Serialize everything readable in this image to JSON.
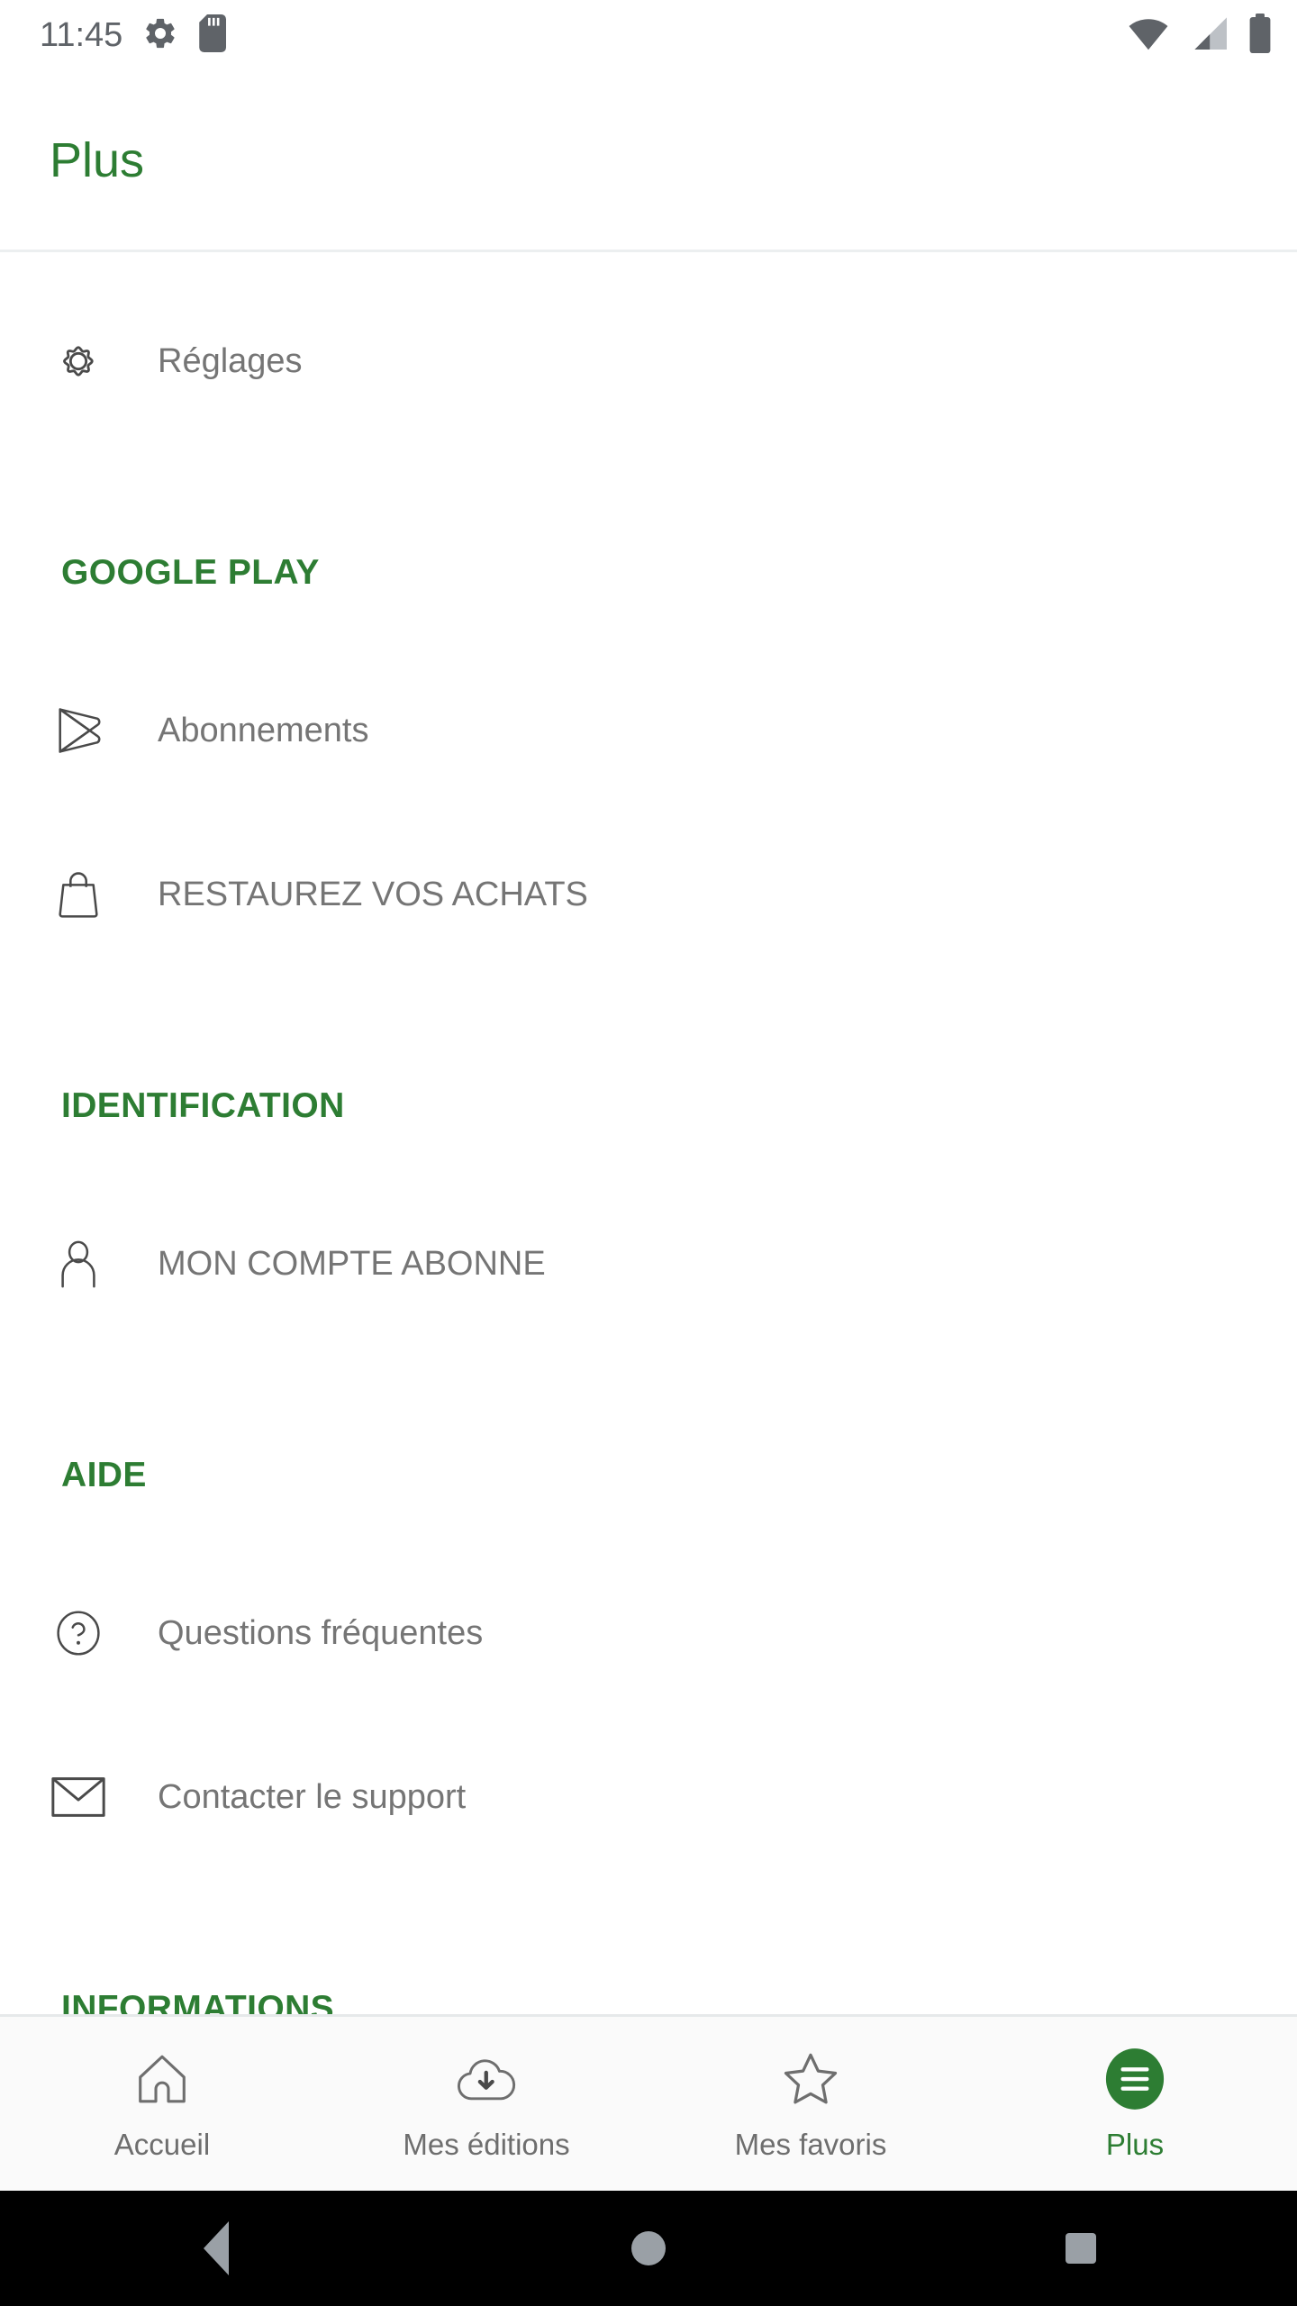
{
  "status_bar": {
    "time": "11:45",
    "left_icons": [
      "gear-icon",
      "sd-card-icon"
    ],
    "right_icons": [
      "wifi-icon",
      "cellular-signal-icon",
      "battery-icon"
    ]
  },
  "app_bar": {
    "title": "Plus"
  },
  "colors": {
    "accent_green": "#2d7d33",
    "label_gray": "#757575",
    "icon_gray": "#5f6368",
    "divider": "#eceff0"
  },
  "content": {
    "top_items": [
      {
        "label": "Réglages",
        "icon": "gear-icon"
      }
    ],
    "sections": [
      {
        "header": "GOOGLE PLAY",
        "items": [
          {
            "label": "Abonnements",
            "icon": "google-play-icon"
          },
          {
            "label": "RESTAUREZ VOS ACHATS",
            "icon": "shopping-bag-icon"
          }
        ]
      },
      {
        "header": "IDENTIFICATION",
        "items": [
          {
            "label": "MON COMPTE ABONNE",
            "icon": "person-icon"
          }
        ]
      },
      {
        "header": "AIDE",
        "items": [
          {
            "label": "Questions fréquentes",
            "icon": "help-circle-icon"
          },
          {
            "label": "Contacter le support",
            "icon": "envelope-icon"
          }
        ]
      },
      {
        "header": "INFORMATIONS",
        "items": []
      }
    ]
  },
  "bottom_nav": {
    "items": [
      {
        "label": "Accueil",
        "icon": "home-icon",
        "active": false
      },
      {
        "label": "Mes éditions",
        "icon": "cloud-download-icon",
        "active": false
      },
      {
        "label": "Mes favoris",
        "icon": "star-icon",
        "active": false
      },
      {
        "label": "Plus",
        "icon": "hamburger-menu-icon",
        "active": true
      }
    ]
  },
  "system_nav": {
    "back": "back-button",
    "home": "home-button",
    "recents": "recents-button"
  }
}
